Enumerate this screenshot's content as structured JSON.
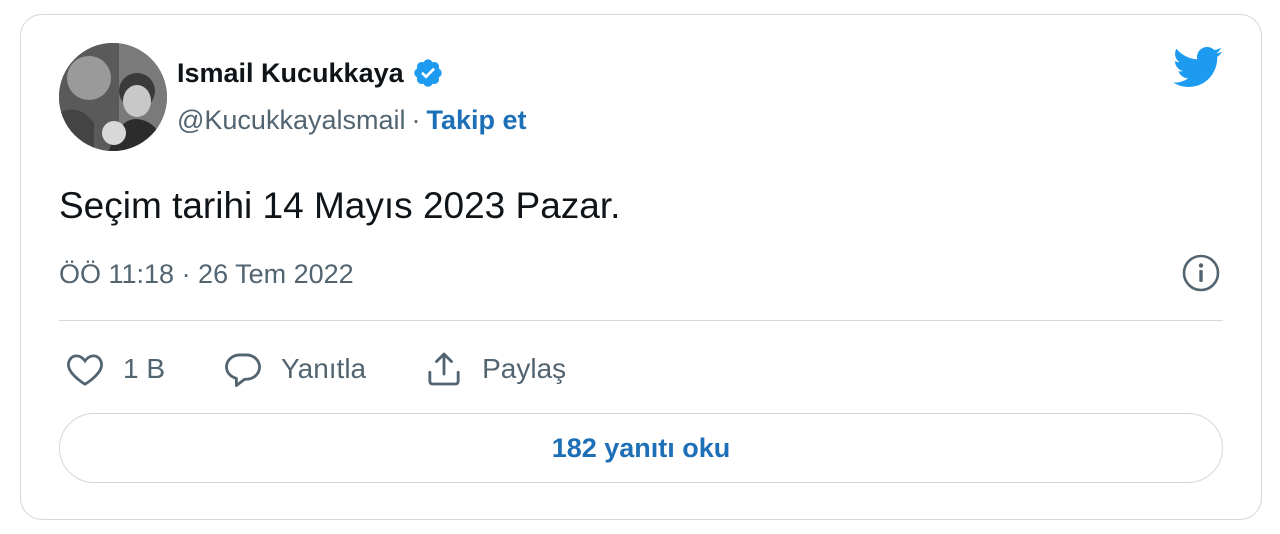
{
  "author": {
    "name": "Ismail Kucukkaya",
    "handle": "@Kucukkayalsmail",
    "separator": "·",
    "follow_label": "Takip et"
  },
  "tweet": {
    "text": "Seçim tarihi 14 Mayıs 2023 Pazar.",
    "timestamp": "ÖÖ 11:18 · 26 Tem 2022"
  },
  "actions": {
    "like_count": "1 B",
    "reply_label": "Yanıtla",
    "share_label": "Paylaş"
  },
  "read_replies_label": "182 yanıtı oku",
  "icons": {
    "brand": "twitter-bird-icon",
    "verified": "verified-badge-icon",
    "info": "info-icon",
    "like": "heart-icon",
    "reply": "speech-bubble-icon",
    "share": "share-icon"
  },
  "colors": {
    "brand_blue": "#1d9bf0",
    "link_blue": "#1d6fb8",
    "text": "#0f1419",
    "secondary_text": "#536471",
    "border": "#cfd9de"
  }
}
